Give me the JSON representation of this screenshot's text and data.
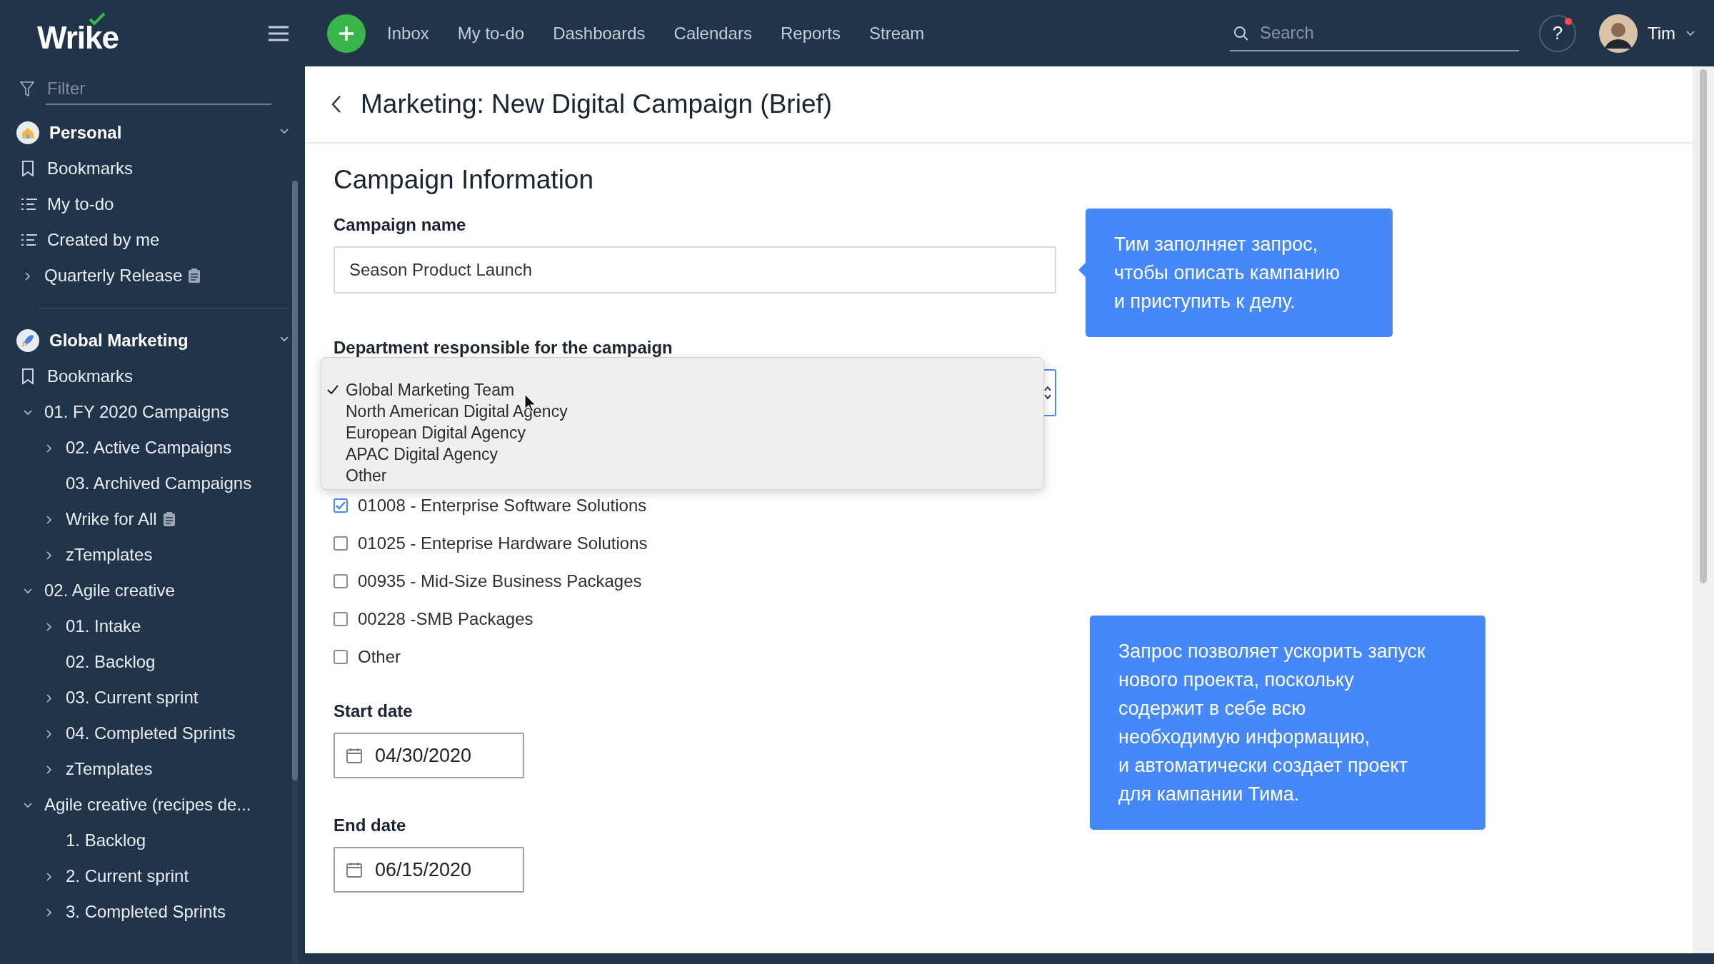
{
  "topbar": {
    "logo": "Wrike",
    "nav": [
      {
        "label": "Inbox",
        "selected": false
      },
      {
        "label": "My to-do",
        "selected": false
      },
      {
        "label": "Dashboards",
        "selected": false
      },
      {
        "label": "Calendars",
        "selected": false
      },
      {
        "label": "Reports",
        "selected": false
      },
      {
        "label": "Stream",
        "selected": false
      }
    ],
    "search": {
      "placeholder": "Search"
    },
    "help": "?",
    "notification": true,
    "user": "Tim"
  },
  "sidebar": {
    "filter": {
      "placeholder": "Filter"
    },
    "sections": [
      {
        "title": "Personal",
        "expanded": true,
        "items": [
          {
            "label": "Bookmarks",
            "kind": "bookmark"
          },
          {
            "label": "My to-do",
            "kind": "list"
          },
          {
            "label": "Created by me",
            "kind": "list"
          },
          {
            "label": "Quarterly Release",
            "kind": "folder",
            "expanded": false,
            "document": true
          }
        ]
      },
      {
        "title": "Global Marketing",
        "expanded": true,
        "items": [
          {
            "label": "Bookmarks",
            "kind": "bookmark"
          },
          {
            "label": "01. FY 2020 Campaigns",
            "kind": "folder",
            "expanded": true,
            "children": [
              {
                "label": "02. Active Campaigns",
                "kind": "folder",
                "expanded": false
              },
              {
                "label": "03. Archived Campaigns",
                "kind": "leaf"
              },
              {
                "label": "Wrike for All",
                "kind": "folder",
                "expanded": false,
                "document": true
              },
              {
                "label": "zTemplates",
                "kind": "folder",
                "expanded": false
              }
            ]
          },
          {
            "label": "02. Agile creative",
            "kind": "folder",
            "expanded": true,
            "children": [
              {
                "label": "01. Intake",
                "kind": "folder",
                "expanded": false
              },
              {
                "label": "02. Backlog",
                "kind": "leaf"
              },
              {
                "label": "03. Current sprint",
                "kind": "folder",
                "expanded": false
              },
              {
                "label": "04. Completed Sprints",
                "kind": "folder",
                "expanded": false
              },
              {
                "label": "zTemplates",
                "kind": "folder",
                "expanded": false
              }
            ]
          },
          {
            "label": "Agile creative (recipes de...",
            "kind": "folder",
            "expanded": true,
            "children": [
              {
                "label": "1. Backlog",
                "kind": "leaf"
              },
              {
                "label": "2. Current sprint",
                "kind": "folder",
                "expanded": false
              },
              {
                "label": "3. Completed Sprints",
                "kind": "folder",
                "expanded": false
              }
            ]
          }
        ]
      }
    ]
  },
  "page": {
    "title": "Marketing: New Digital Campaign (Brief)",
    "section_title": "Campaign Information",
    "campaign_name": {
      "label": "Campaign name",
      "value": "Season Product Launch"
    },
    "department": {
      "label": "Department responsible for the campaign",
      "options": [
        {
          "label": "Global Marketing Team",
          "selected": true
        },
        {
          "label": "North American Digital Agency",
          "selected": false
        },
        {
          "label": "European Digital Agency",
          "selected": false
        },
        {
          "label": "APAC Digital Agency",
          "selected": false
        },
        {
          "label": "Other",
          "selected": false
        }
      ]
    },
    "products": [
      {
        "label": "01008 - Enterprise Software Solutions",
        "checked": true
      },
      {
        "label": "01025 - Enteprise Hardware Solutions",
        "checked": false
      },
      {
        "label": "00935 - Mid-Size Business Packages",
        "checked": false
      },
      {
        "label": "00228 -SMB Packages",
        "checked": false
      },
      {
        "label": "Other",
        "checked": false
      }
    ],
    "start_date": {
      "label": "Start date",
      "value": "04/30/2020"
    },
    "end_date": {
      "label": "End date",
      "value": "06/15/2020"
    }
  },
  "tooltips": [
    {
      "text": "Тим заполняет запрос,\nчтобы описать кампанию\nи приступить к делу.",
      "pointer": true
    },
    {
      "text": "Запрос позволяет ускорить запуск\nнового проекта, поскольку\nсодержит в себе всю\nнеобходимую информацию,\nи автоматически создает проект\nдля кампании Тима.",
      "pointer": false
    }
  ]
}
